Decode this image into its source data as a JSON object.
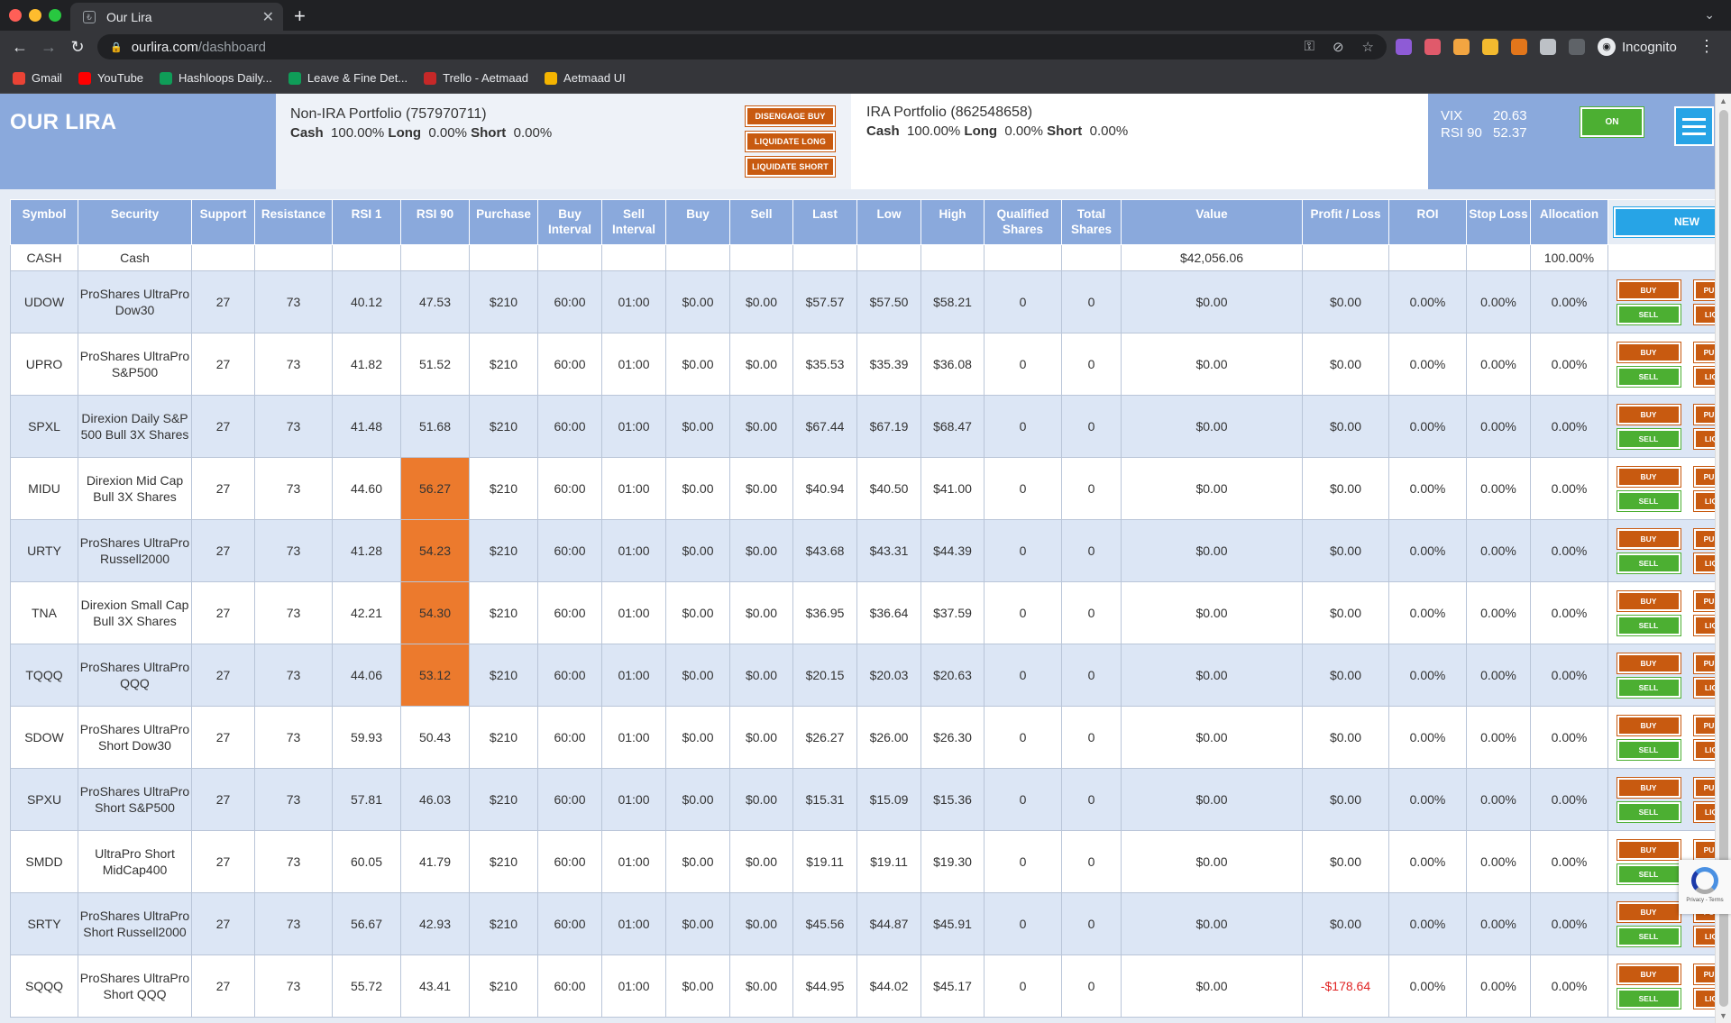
{
  "browser": {
    "tab_title": "Our Lira",
    "url_host": "ourlira.com",
    "url_path": "/dashboard",
    "incognito_label": "Incognito",
    "bookmarks": [
      {
        "label": "Gmail",
        "icon": "gmail-icon",
        "color": "#ea4335"
      },
      {
        "label": "YouTube",
        "icon": "youtube-icon",
        "color": "#ff0000"
      },
      {
        "label": "Hashloops Daily...",
        "icon": "sheets-icon",
        "color": "#0f9d58"
      },
      {
        "label": "Leave & Fine Det...",
        "icon": "sheets-icon",
        "color": "#0f9d58"
      },
      {
        "label": "Trello - Aetmaad",
        "icon": "trello-icon",
        "color": "#c62828"
      },
      {
        "label": "Aetmaad UI",
        "icon": "drive-icon",
        "color": "#f4b400"
      }
    ]
  },
  "app": {
    "brand": "OUR LIRA",
    "non_ira": {
      "title": "Non-IRA Portfolio (757970711)",
      "cash_label": "Cash",
      "cash_value": "100.00%",
      "long_label": "Long",
      "long_value": "0.00%",
      "short_label": "Short",
      "short_value": "0.00%",
      "buttons": [
        "Disengage Buy",
        "Liquidate Long",
        "Liquidate Short"
      ]
    },
    "ira": {
      "title": "IRA Portfolio (862548658)",
      "cash_label": "Cash",
      "cash_value": "100.00%",
      "long_label": "Long",
      "long_value": "0.00%",
      "short_label": "Short",
      "short_value": "0.00%"
    },
    "market": {
      "vix_label": "VIX",
      "vix_value": "20.63",
      "rsi_label": "RSI 90",
      "rsi_value": "52.37",
      "toggle_label": "ON"
    }
  },
  "table": {
    "columns": [
      "Symbol",
      "Security",
      "Support",
      "Resistance",
      "RSI 1",
      "RSI 90",
      "Purchase",
      "Buy Interval",
      "Sell Interval",
      "Buy",
      "Sell",
      "Last",
      "Low",
      "High",
      "Qualified Shares",
      "Total Shares",
      "Value",
      "Profit / Loss",
      "ROI",
      "Stop Loss",
      "Allocation"
    ],
    "new_button": "NEW",
    "action_labels": {
      "buy": "Buy",
      "purchase": "Purchase",
      "sell": "Sell",
      "liquidate": "Liquidate"
    },
    "cash_row": {
      "symbol": "CASH",
      "security": "Cash",
      "value": "$42,056.06",
      "allocation": "100.00%"
    },
    "rows": [
      {
        "symbol": "UDOW",
        "security": "ProShares UltraPro Dow30",
        "support": "27",
        "resistance": "73",
        "rsi1": "40.12",
        "rsi90": "47.53",
        "purchase": "$210",
        "buy_interval": "60:00",
        "sell_interval": "01:00",
        "buy": "$0.00",
        "sell": "$0.00",
        "last": "$57.57",
        "low": "$57.50",
        "high": "$58.21",
        "qualified": "0",
        "total": "0",
        "value": "$0.00",
        "pl": "$0.00",
        "roi": "0.00%",
        "stop": "0.00%",
        "alloc": "0.00%",
        "hot": false,
        "neg": false
      },
      {
        "symbol": "UPRO",
        "security": "ProShares UltraPro S&P500",
        "support": "27",
        "resistance": "73",
        "rsi1": "41.82",
        "rsi90": "51.52",
        "purchase": "$210",
        "buy_interval": "60:00",
        "sell_interval": "01:00",
        "buy": "$0.00",
        "sell": "$0.00",
        "last": "$35.53",
        "low": "$35.39",
        "high": "$36.08",
        "qualified": "0",
        "total": "0",
        "value": "$0.00",
        "pl": "$0.00",
        "roi": "0.00%",
        "stop": "0.00%",
        "alloc": "0.00%",
        "hot": false,
        "neg": false
      },
      {
        "symbol": "SPXL",
        "security": "Direxion Daily S&P 500 Bull 3X Shares",
        "support": "27",
        "resistance": "73",
        "rsi1": "41.48",
        "rsi90": "51.68",
        "purchase": "$210",
        "buy_interval": "60:00",
        "sell_interval": "01:00",
        "buy": "$0.00",
        "sell": "$0.00",
        "last": "$67.44",
        "low": "$67.19",
        "high": "$68.47",
        "qualified": "0",
        "total": "0",
        "value": "$0.00",
        "pl": "$0.00",
        "roi": "0.00%",
        "stop": "0.00%",
        "alloc": "0.00%",
        "hot": false,
        "neg": false
      },
      {
        "symbol": "MIDU",
        "security": "Direxion Mid Cap Bull 3X Shares",
        "support": "27",
        "resistance": "73",
        "rsi1": "44.60",
        "rsi90": "56.27",
        "purchase": "$210",
        "buy_interval": "60:00",
        "sell_interval": "01:00",
        "buy": "$0.00",
        "sell": "$0.00",
        "last": "$40.94",
        "low": "$40.50",
        "high": "$41.00",
        "qualified": "0",
        "total": "0",
        "value": "$0.00",
        "pl": "$0.00",
        "roi": "0.00%",
        "stop": "0.00%",
        "alloc": "0.00%",
        "hot": true,
        "neg": false
      },
      {
        "symbol": "URTY",
        "security": "ProShares UltraPro Russell2000",
        "support": "27",
        "resistance": "73",
        "rsi1": "41.28",
        "rsi90": "54.23",
        "purchase": "$210",
        "buy_interval": "60:00",
        "sell_interval": "01:00",
        "buy": "$0.00",
        "sell": "$0.00",
        "last": "$43.68",
        "low": "$43.31",
        "high": "$44.39",
        "qualified": "0",
        "total": "0",
        "value": "$0.00",
        "pl": "$0.00",
        "roi": "0.00%",
        "stop": "0.00%",
        "alloc": "0.00%",
        "hot": true,
        "neg": false
      },
      {
        "symbol": "TNA",
        "security": "Direxion Small Cap Bull 3X Shares",
        "support": "27",
        "resistance": "73",
        "rsi1": "42.21",
        "rsi90": "54.30",
        "purchase": "$210",
        "buy_interval": "60:00",
        "sell_interval": "01:00",
        "buy": "$0.00",
        "sell": "$0.00",
        "last": "$36.95",
        "low": "$36.64",
        "high": "$37.59",
        "qualified": "0",
        "total": "0",
        "value": "$0.00",
        "pl": "$0.00",
        "roi": "0.00%",
        "stop": "0.00%",
        "alloc": "0.00%",
        "hot": true,
        "neg": false
      },
      {
        "symbol": "TQQQ",
        "security": "ProShares UltraPro QQQ",
        "support": "27",
        "resistance": "73",
        "rsi1": "44.06",
        "rsi90": "53.12",
        "purchase": "$210",
        "buy_interval": "60:00",
        "sell_interval": "01:00",
        "buy": "$0.00",
        "sell": "$0.00",
        "last": "$20.15",
        "low": "$20.03",
        "high": "$20.63",
        "qualified": "0",
        "total": "0",
        "value": "$0.00",
        "pl": "$0.00",
        "roi": "0.00%",
        "stop": "0.00%",
        "alloc": "0.00%",
        "hot": true,
        "neg": false
      },
      {
        "symbol": "SDOW",
        "security": "ProShares UltraPro Short Dow30",
        "support": "27",
        "resistance": "73",
        "rsi1": "59.93",
        "rsi90": "50.43",
        "purchase": "$210",
        "buy_interval": "60:00",
        "sell_interval": "01:00",
        "buy": "$0.00",
        "sell": "$0.00",
        "last": "$26.27",
        "low": "$26.00",
        "high": "$26.30",
        "qualified": "0",
        "total": "0",
        "value": "$0.00",
        "pl": "$0.00",
        "roi": "0.00%",
        "stop": "0.00%",
        "alloc": "0.00%",
        "hot": false,
        "neg": false
      },
      {
        "symbol": "SPXU",
        "security": "ProShares UltraPro Short S&P500",
        "support": "27",
        "resistance": "73",
        "rsi1": "57.81",
        "rsi90": "46.03",
        "purchase": "$210",
        "buy_interval": "60:00",
        "sell_interval": "01:00",
        "buy": "$0.00",
        "sell": "$0.00",
        "last": "$15.31",
        "low": "$15.09",
        "high": "$15.36",
        "qualified": "0",
        "total": "0",
        "value": "$0.00",
        "pl": "$0.00",
        "roi": "0.00%",
        "stop": "0.00%",
        "alloc": "0.00%",
        "hot": false,
        "neg": false
      },
      {
        "symbol": "SMDD",
        "security": "UltraPro Short MidCap400",
        "support": "27",
        "resistance": "73",
        "rsi1": "60.05",
        "rsi90": "41.79",
        "purchase": "$210",
        "buy_interval": "60:00",
        "sell_interval": "01:00",
        "buy": "$0.00",
        "sell": "$0.00",
        "last": "$19.11",
        "low": "$19.11",
        "high": "$19.30",
        "qualified": "0",
        "total": "0",
        "value": "$0.00",
        "pl": "$0.00",
        "roi": "0.00%",
        "stop": "0.00%",
        "alloc": "0.00%",
        "hot": false,
        "neg": false
      },
      {
        "symbol": "SRTY",
        "security": "ProShares UltraPro Short Russell2000",
        "support": "27",
        "resistance": "73",
        "rsi1": "56.67",
        "rsi90": "42.93",
        "purchase": "$210",
        "buy_interval": "60:00",
        "sell_interval": "01:00",
        "buy": "$0.00",
        "sell": "$0.00",
        "last": "$45.56",
        "low": "$44.87",
        "high": "$45.91",
        "qualified": "0",
        "total": "0",
        "value": "$0.00",
        "pl": "$0.00",
        "roi": "0.00%",
        "stop": "0.00%",
        "alloc": "0.00%",
        "hot": false,
        "neg": false
      },
      {
        "symbol": "SQQQ",
        "security": "ProShares UltraPro Short QQQ",
        "support": "27",
        "resistance": "73",
        "rsi1": "55.72",
        "rsi90": "43.41",
        "purchase": "$210",
        "buy_interval": "60:00",
        "sell_interval": "01:00",
        "buy": "$0.00",
        "sell": "$0.00",
        "last": "$44.95",
        "low": "$44.02",
        "high": "$45.17",
        "qualified": "0",
        "total": "0",
        "value": "$0.00",
        "pl": "-$178.64",
        "roi": "0.00%",
        "stop": "0.00%",
        "alloc": "0.00%",
        "hot": false,
        "neg": true
      }
    ]
  },
  "recaptcha": {
    "text": "Privacy - Terms"
  }
}
